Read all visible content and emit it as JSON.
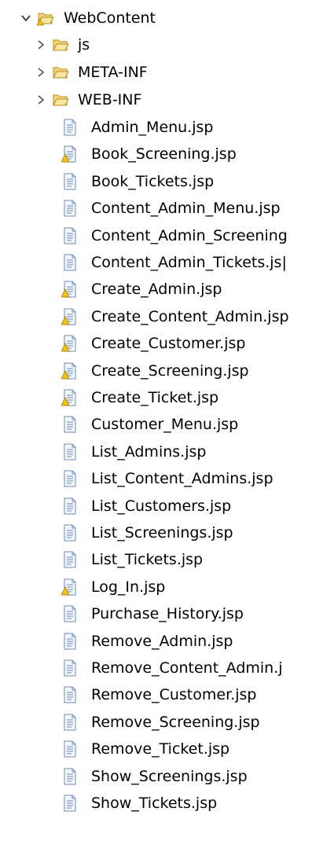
{
  "tree": {
    "root": {
      "label": "WebContent",
      "expanded": true,
      "icon": "folder-open-warning-icon"
    },
    "folders": [
      {
        "label": "js",
        "expanded": false,
        "icon": "folder-icon"
      },
      {
        "label": "META-INF",
        "expanded": false,
        "icon": "folder-icon"
      },
      {
        "label": "WEB-INF",
        "expanded": false,
        "icon": "folder-icon"
      }
    ],
    "files": [
      {
        "label": "Admin_Menu.jsp",
        "warning": false
      },
      {
        "label": "Book_Screening.jsp",
        "warning": true
      },
      {
        "label": "Book_Tickets.jsp",
        "warning": false
      },
      {
        "label": "Content_Admin_Menu.jsp",
        "warning": false
      },
      {
        "label": "Content_Admin_Screening",
        "warning": false
      },
      {
        "label": "Content_Admin_Tickets.js|",
        "warning": false
      },
      {
        "label": "Create_Admin.jsp",
        "warning": true
      },
      {
        "label": "Create_Content_Admin.jsp",
        "warning": true
      },
      {
        "label": "Create_Customer.jsp",
        "warning": true
      },
      {
        "label": "Create_Screening.jsp",
        "warning": true
      },
      {
        "label": "Create_Ticket.jsp",
        "warning": true
      },
      {
        "label": "Customer_Menu.jsp",
        "warning": false
      },
      {
        "label": "List_Admins.jsp",
        "warning": false
      },
      {
        "label": "List_Content_Admins.jsp",
        "warning": false
      },
      {
        "label": "List_Customers.jsp",
        "warning": false
      },
      {
        "label": "List_Screenings.jsp",
        "warning": false
      },
      {
        "label": "List_Tickets.jsp",
        "warning": false
      },
      {
        "label": "Log_In.jsp",
        "warning": true
      },
      {
        "label": "Purchase_History.jsp",
        "warning": false
      },
      {
        "label": "Remove_Admin.jsp",
        "warning": false
      },
      {
        "label": "Remove_Content_Admin.j",
        "warning": false
      },
      {
        "label": "Remove_Customer.jsp",
        "warning": false
      },
      {
        "label": "Remove_Screening.jsp",
        "warning": false
      },
      {
        "label": "Remove_Ticket.jsp",
        "warning": false
      },
      {
        "label": "Show_Screenings.jsp",
        "warning": false
      },
      {
        "label": "Show_Tickets.jsp",
        "warning": false
      }
    ]
  },
  "colors": {
    "text": "#000000",
    "chevron": "#444444",
    "folder_fill": "#f6d57a",
    "folder_stroke": "#b98a1c",
    "file_fill": "#f4f7fb",
    "file_stroke": "#6d8eb6",
    "file_lines": "#7a9cc6",
    "warning_fill": "#f3c21a",
    "warning_stroke": "#a07a00"
  }
}
